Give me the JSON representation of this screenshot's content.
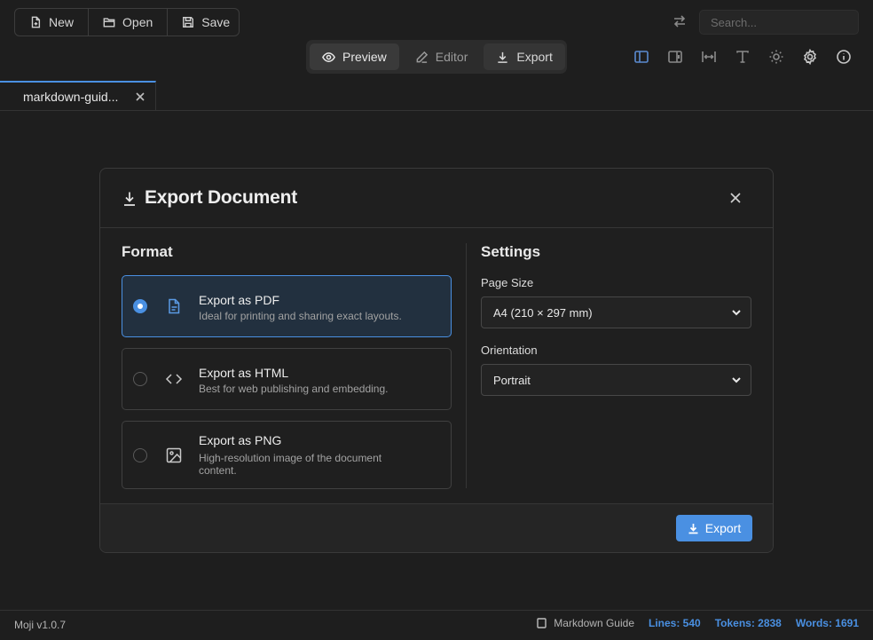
{
  "toolbar": {
    "new_label": "New",
    "open_label": "Open",
    "save_label": "Save"
  },
  "search": {
    "placeholder": "Search..."
  },
  "mode_tabs": [
    {
      "label": "Preview",
      "icon": "eye-icon",
      "active": true
    },
    {
      "label": "Editor",
      "icon": "pencil-icon",
      "active": false
    },
    {
      "label": "Export",
      "icon": "download-icon",
      "active": false
    }
  ],
  "tool_icons": [
    "sidebar-left-icon",
    "sidebar-right-icon",
    "width-icon",
    "typography-icon",
    "sun-icon",
    "gear-icon",
    "info-icon"
  ],
  "file_tab": {
    "label": "markdown-guid..."
  },
  "dialog": {
    "title": "Export Document",
    "format_heading": "Format",
    "settings_heading": "Settings",
    "options": [
      {
        "title": "Export as PDF",
        "desc": "Ideal for printing and sharing exact layouts.",
        "icon": "file-text-icon",
        "selected": true
      },
      {
        "title": "Export as HTML",
        "desc": "Best for web publishing and embedding.",
        "icon": "code-icon",
        "selected": false
      },
      {
        "title": "Export as PNG",
        "desc": "High-resolution image of the document content.",
        "icon": "image-icon",
        "selected": false
      }
    ],
    "page_size_label": "Page Size",
    "page_size_value": "A4 (210 × 297 mm)",
    "orientation_label": "Orientation",
    "orientation_value": "Portrait",
    "export_button": "Export"
  },
  "status": {
    "version": "Moji v1.0.7",
    "document": "Markdown Guide",
    "lines": "Lines: 540",
    "tokens": "Tokens: 2838",
    "words": "Words: 1691"
  },
  "colors": {
    "accent": "#4a90e2",
    "background": "#1e1e1e"
  }
}
